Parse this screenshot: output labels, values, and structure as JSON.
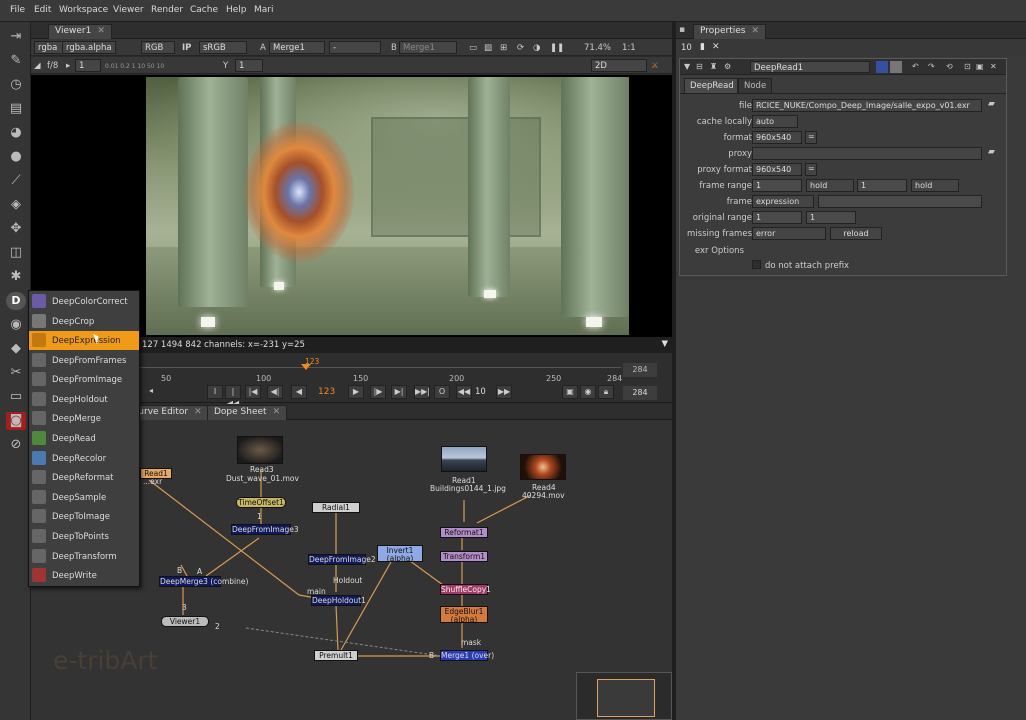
{
  "menubar": {
    "items": [
      "File",
      "Edit",
      "Workspace",
      "Viewer",
      "Render",
      "Cache",
      "Help",
      "Mari"
    ]
  },
  "viewer": {
    "tab_label": "Viewer1",
    "channels": "rgba",
    "alpha": "rgba.alpha",
    "color_mode": "RGB",
    "ip_label": "IP",
    "colorspace": "sRGB",
    "input_a_label": "A",
    "input_a": "Merge1",
    "wipe": "-",
    "input_b_label": "B",
    "input_b": "Merge1",
    "zoom": "71.4%",
    "proxy": "1:1",
    "fstop_label": "f/8",
    "gain_value": "1",
    "y_label": "Y",
    "gamma_value": "1",
    "view_mode": "2D",
    "info_text": "127 1494 842 channels: x=-231 y=25",
    "gain_ticks": "0.01 0.2 1 10 50 10"
  },
  "timeline": {
    "current_frame": "123",
    "end_frame": "284",
    "ticks": [
      "50",
      "100",
      "150",
      "200",
      "250",
      "284"
    ],
    "frame_field": "123",
    "step_value": "10",
    "end_field": "284",
    "buttons": {
      "first": "|◀◀",
      "prev_key": "|◀",
      "prev_frame": "◀|",
      "play_back": "◀",
      "play": "▶",
      "next_frame": "|▶",
      "next_key": "▶|",
      "last": "▶▶|",
      "stop": "O",
      "rewind": "◀◀",
      "forward": "▶▶"
    }
  },
  "dag_tabs": [
    "Curve Editor",
    "Dope Sheet"
  ],
  "nodes": {
    "read_left": "Read1",
    "read_left_file": "...exr",
    "read3": "Read3",
    "read3_file": "Dust_wave_01.mov",
    "timeoffset": "TimeOffset1",
    "timeoffset_input": "1",
    "deepfromimage3": "DeepFromImage3",
    "deepmerge3": "DeepMerge3 (combine)",
    "input_a": "A",
    "input_b": "B",
    "input_3": "3",
    "viewer1": "Viewer1",
    "input_2": "2",
    "radial1": "Radial1",
    "deepfromimage2": "DeepFromImage2",
    "holdout_label": "Holdout",
    "main_label": "main",
    "deepholdout1": "DeepHoldout1",
    "premult1": "Premult1",
    "invert1": "Invert1",
    "invert1_sub": "(alpha)",
    "read1": "Read1",
    "read1_file": "Buildings0144_1.jpg",
    "read4": "Read4",
    "read4_file": "40294.mov",
    "reformat1": "Reformat1",
    "transform1": "Transform1",
    "shuffle": "ShuffleCopy1",
    "edgeblur1": "EdgeBlur1",
    "edgeblur1_sub": "(alpha)",
    "mask_label": "mask",
    "merge1": "Merge1 (over)",
    "b_label": "B"
  },
  "watermark": "e-tribArt",
  "context_menu": {
    "highlighted": "DeepExpression",
    "items": [
      "DeepColorCorrect",
      "DeepCrop",
      "DeepExpression",
      "DeepFromFrames",
      "DeepFromImage",
      "DeepHoldout",
      "DeepMerge",
      "DeepRead",
      "DeepRecolor",
      "DeepReformat",
      "DeepSample",
      "DeepToImage",
      "DeepToPoints",
      "DeepTransform",
      "DeepWrite"
    ]
  },
  "properties": {
    "tab_label": "Properties",
    "max_panels": "10",
    "node_name": "DeepRead1",
    "tabs": [
      "DeepRead",
      "Node"
    ],
    "file_label": "file",
    "file_value": "RCICE_NUKE/Compo_Deep_Image/salle_expo_v01.exr",
    "cache_label": "cache locally",
    "cache_value": "auto",
    "format_label": "format",
    "format_value": "960x540",
    "proxy_label": "proxy",
    "proxy_format_label": "proxy format",
    "proxy_format_value": "960x540",
    "frame_range_label": "frame range",
    "frame_range_start": "1",
    "before_mode": "hold",
    "frame_range_end": "1",
    "after_mode": "hold",
    "frame_label": "frame",
    "frame_mode": "expression",
    "original_range_label": "original range",
    "original_start": "1",
    "original_end": "1",
    "missing_frames_label": "missing frames",
    "missing_frames_value": "error",
    "reload_label": "reload",
    "exr_options_label": "exr Options",
    "prefix_label": "do not attach prefix",
    "equals": "="
  }
}
